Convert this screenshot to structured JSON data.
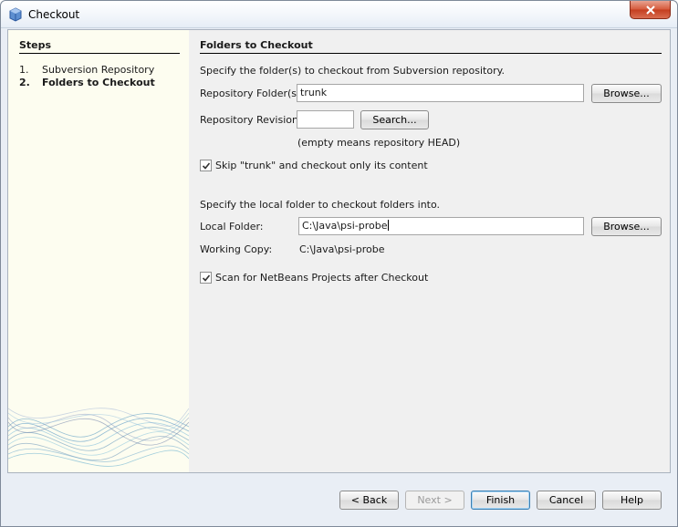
{
  "window": {
    "title": "Checkout"
  },
  "steps": {
    "title": "Steps",
    "items": [
      {
        "num": "1.",
        "label": "Subversion Repository",
        "active": false
      },
      {
        "num": "2.",
        "label": "Folders to Checkout",
        "active": true
      }
    ]
  },
  "main": {
    "title": "Folders to Checkout",
    "intro": "Specify the folder(s) to checkout from Subversion repository.",
    "repo_folder_label": "Repository Folder(s):",
    "repo_folder_value": "trunk",
    "browse1_label": "Browse...",
    "revision_label": "Repository Revision:",
    "revision_value": "",
    "search_label": "Search...",
    "revision_hint": "(empty means repository HEAD)",
    "skip_trunk_label": "Skip \"trunk\" and checkout only its content",
    "skip_trunk_checked": true,
    "local_intro": "Specify the local folder to checkout folders into.",
    "local_folder_label": "Local Folder:",
    "local_folder_value": "C:\\Java\\psi-probe",
    "browse2_label": "Browse...",
    "working_copy_label": "Working Copy:",
    "working_copy_value": "C:\\Java\\psi-probe",
    "scan_label": "Scan for NetBeans Projects after Checkout",
    "scan_checked": true
  },
  "footer": {
    "back": "< Back",
    "next": "Next >",
    "finish": "Finish",
    "cancel": "Cancel",
    "help": "Help"
  },
  "colors": {
    "accent": "#3c7fb1",
    "close": "#c43e1f",
    "steps_bg": "#fdfdf0"
  }
}
